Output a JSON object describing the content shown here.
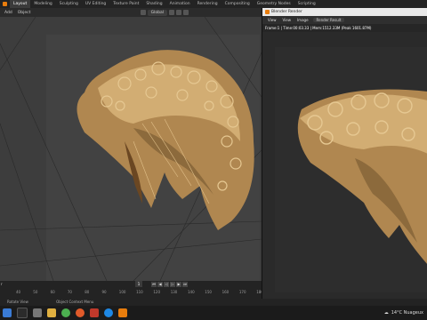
{
  "workspace_tabs": [
    "Layout",
    "Modeling",
    "Sculpting",
    "UV Editing",
    "Texture Paint",
    "Shading",
    "Animation",
    "Rendering",
    "Compositing",
    "Geometry Nodes",
    "Scripting"
  ],
  "active_tab": "Layout",
  "scene_label": "Scene",
  "toolbar": {
    "add_label": "Add",
    "object_label": "Object",
    "transform_orientation": "Global"
  },
  "timeline": {
    "left_label": "r",
    "current_frame": "1",
    "ticks": [
      "40",
      "50",
      "60",
      "70",
      "80",
      "90",
      "100",
      "110",
      "120",
      "130",
      "140",
      "150",
      "160",
      "170",
      "180"
    ]
  },
  "status_bar": {
    "left_text": "Rotate View",
    "right_text": "Object Context Menu"
  },
  "render_window": {
    "title": "Blender Render",
    "menu": [
      "View",
      "View",
      "Image"
    ],
    "slot": "Render Result",
    "info": "Frame:1 | Time:00:03.33 | Mem:1512.33M (Peak 1601.87M)"
  },
  "taskbar": {
    "weather": "14°C Nuageux"
  },
  "colors": {
    "accent_orange": "#e87d0d",
    "hair_light": "#d9b47a",
    "hair_dark": "#6b4722"
  }
}
